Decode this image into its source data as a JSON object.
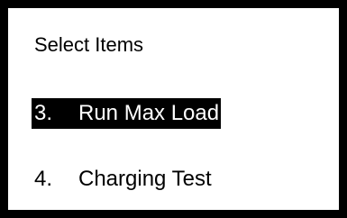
{
  "screen": {
    "title": "Select Items",
    "menu": [
      {
        "number": "3.",
        "label": "Run Max Load",
        "selected": true
      },
      {
        "number": "4.",
        "label": "Charging Test",
        "selected": false
      }
    ]
  },
  "colors": {
    "border": "#000000",
    "background": "#ffffff",
    "highlight_bg": "#000000",
    "highlight_text": "#ffffff",
    "text": "#000000"
  }
}
